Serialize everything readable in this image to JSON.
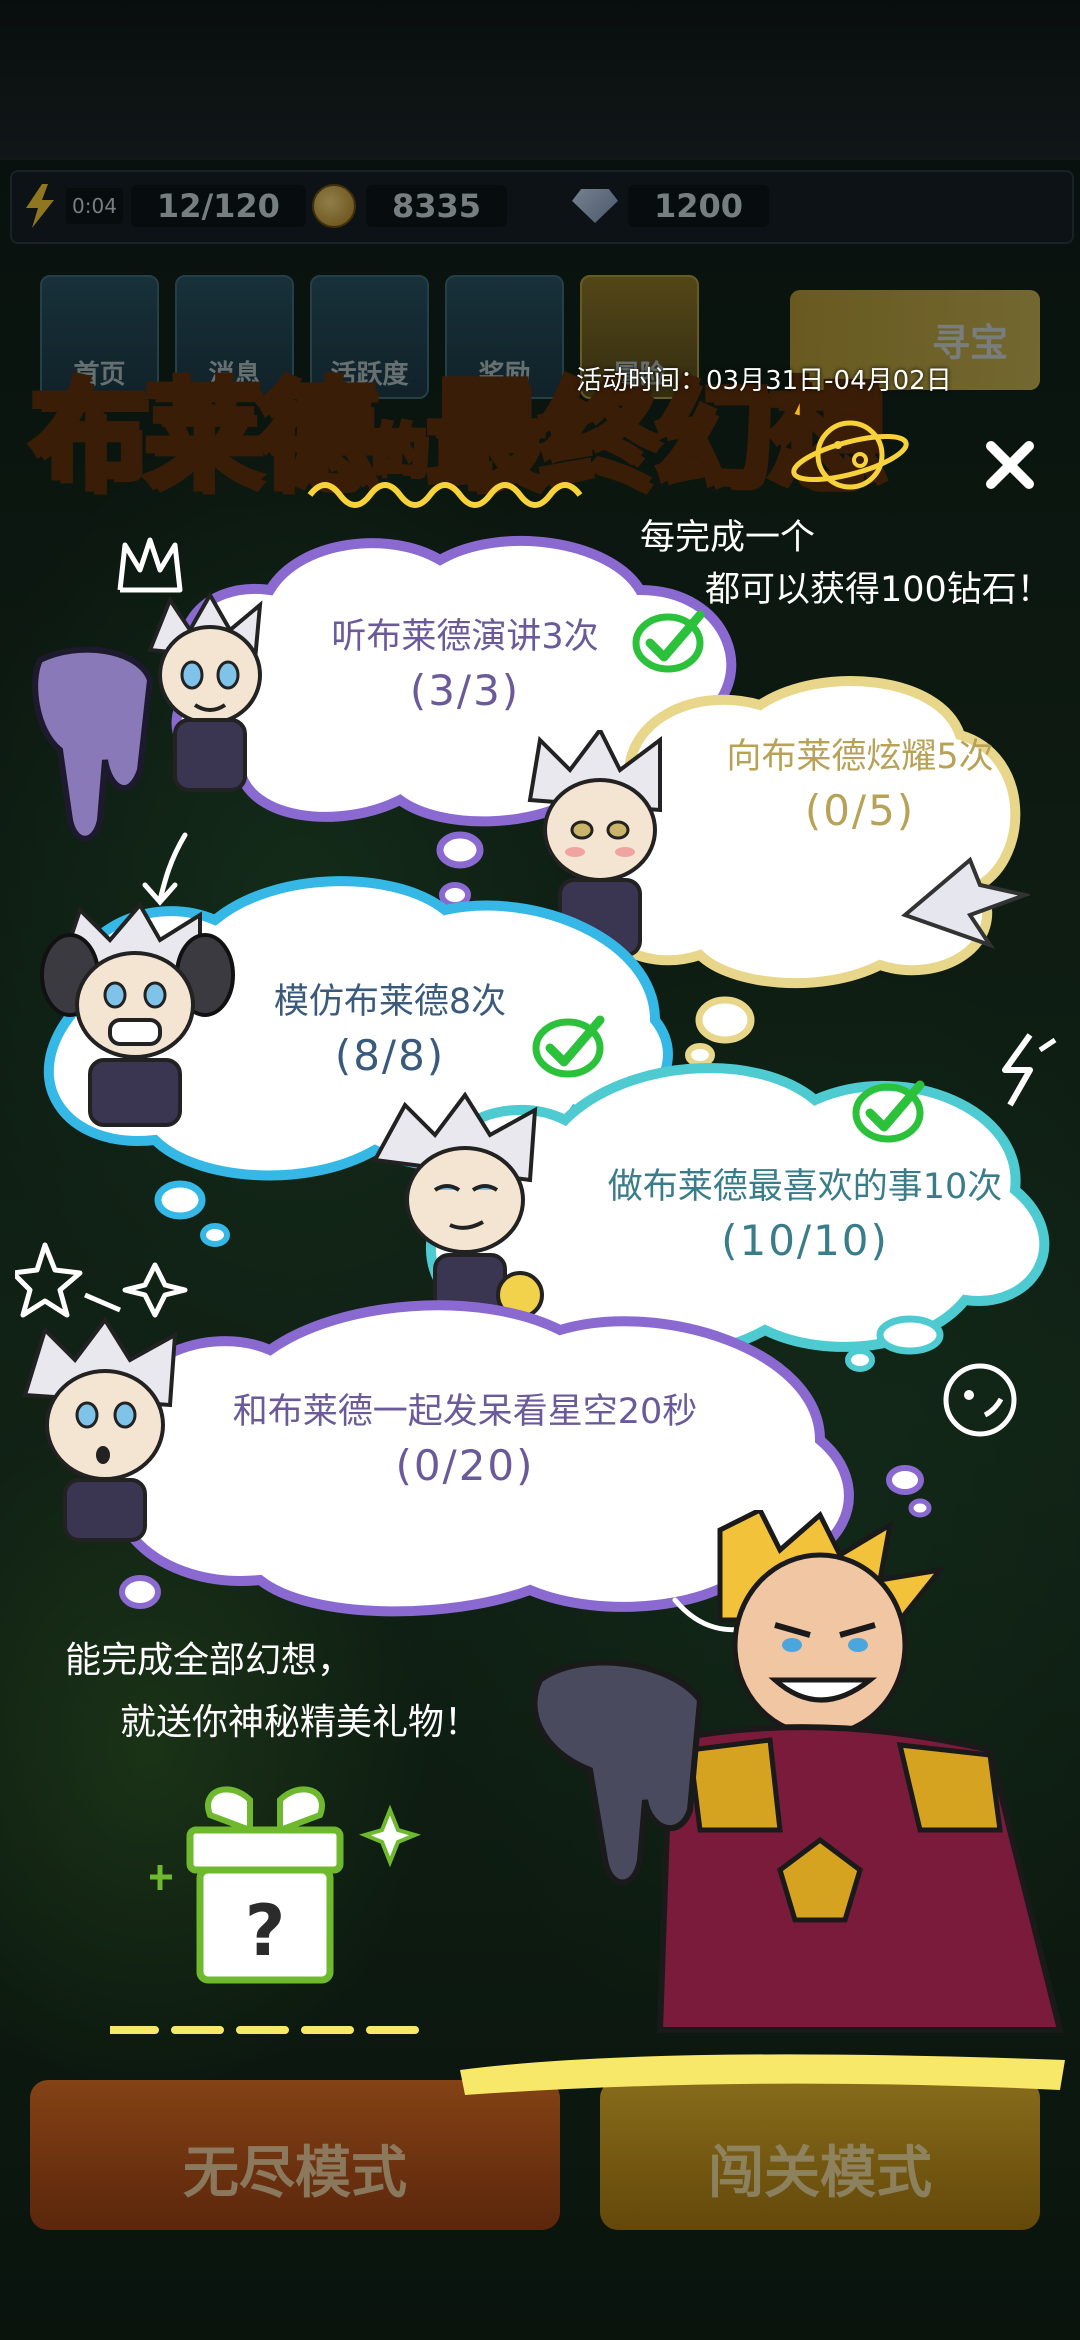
{
  "resources": {
    "energy_timer": "0:04",
    "energy": "12/120",
    "coins": "8335",
    "gems": "1200"
  },
  "tabs": [
    "首页",
    "消息",
    "活跃度",
    "奖励",
    "冒险"
  ],
  "treasure_tab": "寻宝",
  "bottom_buttons": {
    "left": "无尽模式",
    "right": "闯关模式"
  },
  "event": {
    "title_part1": "布莱德",
    "title_connector": "的",
    "title_part2": "最终幻想",
    "time_label": "活动时间：03月31日-04月02日",
    "reward_note_line1": "每完成一个",
    "reward_note_line2": "都可以获得100钻石！",
    "tasks": [
      {
        "label": "听布莱德演讲3次",
        "progress": "(3/3)",
        "done": true
      },
      {
        "label": "向布莱德炫耀5次",
        "progress": "(0/5)",
        "done": false
      },
      {
        "label": "模仿布莱德8次",
        "progress": "(8/8)",
        "done": true
      },
      {
        "label": "做布莱德最喜欢的事10次",
        "progress": "(10/10)",
        "done": true
      },
      {
        "label": "和布莱德一起发呆看星空20秒",
        "progress": "(0/20)",
        "done": false
      }
    ],
    "finish_note_line1": "能完成全部幻想，",
    "finish_note_line2": "就送你神秘精美礼物！",
    "gift_symbol": "?"
  },
  "colors": {
    "title": "#f7b81b",
    "purple_outline": "#8a6ad0",
    "blue_outline": "#35b8e6",
    "cream_outline": "#e8d68a",
    "teal_outline": "#4ecbd0",
    "text_purple": "#6a5a9a",
    "text_teal": "#3a7d8a",
    "text_gold": "#b8a256",
    "check_green": "#2cc13a"
  }
}
